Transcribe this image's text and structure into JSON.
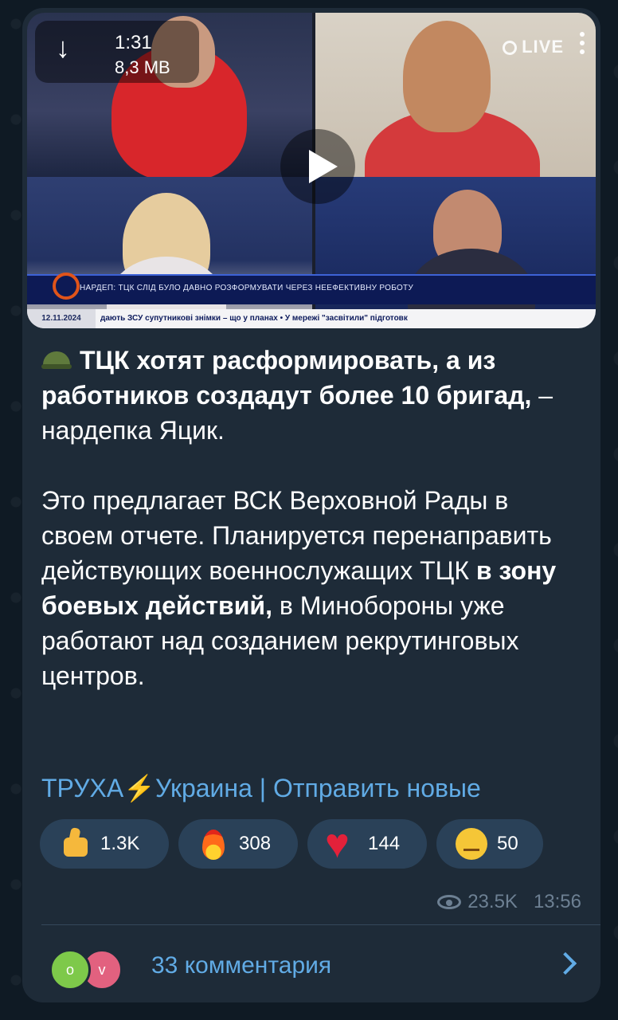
{
  "video": {
    "duration": "1:31",
    "size": "8,3 MB",
    "live_label": "LIVE",
    "ticker_headline": "НАРДЕП: ТЦК СЛІД БУЛО ДАВНО РОЗФОРМУВАТИ ЧЕРЕЗ НЕЕФЕКТИВНУ РОБОТУ",
    "ticker_date": "12.11.2024",
    "ticker_crawl": "дають ЗСУ супутникові знімки – що у планах • У мережі \"засвітили\" підготовк"
  },
  "post": {
    "title_bold": "ТЦК хотят расформировать, а из работников создадут более 10 бригад,",
    "title_rest": " – нардепка Яцик.",
    "body_1": "Это предлагает ВСК Верховной Рады в своем отчете. Планируется перенаправить действующих военнослужащих ТЦК ",
    "body_bold": "в зону боевых действий,",
    "body_2": " в Минобороны уже работают над созданием рекрутинговых центров.",
    "link": "ТРУХА⚡Украина | Отправить новые"
  },
  "reactions": [
    {
      "icon": "thumbs-up",
      "count": "1.3K"
    },
    {
      "icon": "fire",
      "count": "308"
    },
    {
      "icon": "heart",
      "count": "144"
    },
    {
      "icon": "raised-eyebrow-face",
      "count": "50"
    }
  ],
  "meta": {
    "views": "23.5K",
    "time": "13:56"
  },
  "comments": {
    "avatars": [
      "o",
      "v"
    ],
    "label": "33 комментария"
  }
}
